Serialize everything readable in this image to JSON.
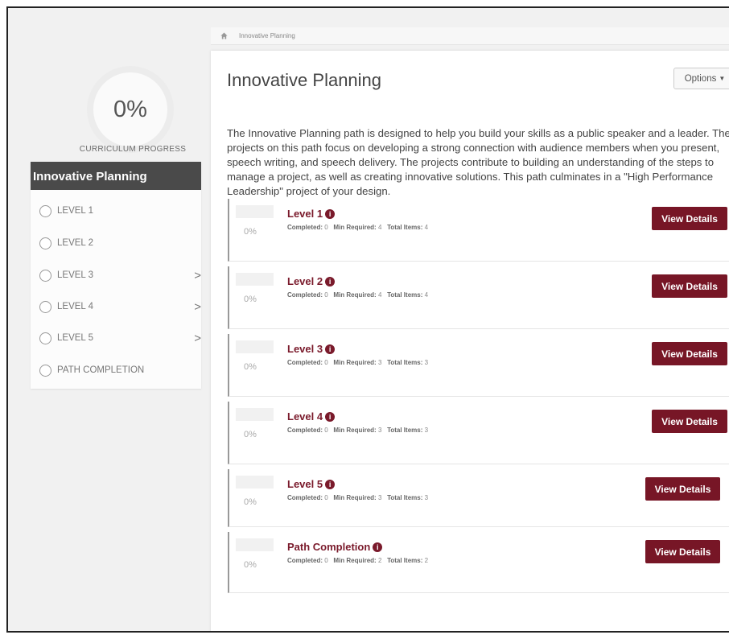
{
  "curriculum": {
    "percent": "0%",
    "label": "CURRICULUM PROGRESS"
  },
  "sidebar": {
    "title": "Innovative Planning",
    "items": [
      {
        "label": "LEVEL 1",
        "chevron": ""
      },
      {
        "label": "LEVEL 2",
        "chevron": ""
      },
      {
        "label": "LEVEL 3",
        "chevron": ">"
      },
      {
        "label": "LEVEL 4",
        "chevron": ">"
      },
      {
        "label": "LEVEL 5",
        "chevron": ">"
      },
      {
        "label": "PATH COMPLETION",
        "chevron": ""
      }
    ]
  },
  "breadcrumb": {
    "home_icon": "home-icon",
    "current": "Innovative Planning"
  },
  "main": {
    "title": "Innovative Planning",
    "options_label": "Options",
    "description": "The Innovative Planning path is designed to help you build your skills as a public speaker and a leader. The projects on this path focus on developing a strong connection with audience members when you present, speech writing, and speech delivery. The projects contribute to building an understanding of the steps to manage a project, as well as creating innovative solutions. This path culminates in a \"High Performance Leadership\" project of your design.",
    "levels": [
      {
        "title": "Level 1",
        "percent": "0%",
        "completed_label": "Completed:",
        "completed": "0",
        "min_label": "Min Required:",
        "min_required": "4",
        "total_label": "Total Items:",
        "total_items": "4",
        "button": "View Details"
      },
      {
        "title": "Level 2",
        "percent": "0%",
        "completed_label": "Completed:",
        "completed": "0",
        "min_label": "Min Required:",
        "min_required": "4",
        "total_label": "Total Items:",
        "total_items": "4",
        "button": "View Details"
      },
      {
        "title": "Level 3",
        "percent": "0%",
        "completed_label": "Completed:",
        "completed": "0",
        "min_label": "Min Required:",
        "min_required": "3",
        "total_label": "Total Items:",
        "total_items": "3",
        "button": "View Details"
      },
      {
        "title": "Level 4",
        "percent": "0%",
        "completed_label": "Completed:",
        "completed": "0",
        "min_label": "Min Required:",
        "min_required": "3",
        "total_label": "Total Items:",
        "total_items": "3",
        "button": "View Details"
      },
      {
        "title": "Level 5",
        "percent": "0%",
        "completed_label": "Completed:",
        "completed": "0",
        "min_label": "Min Required:",
        "min_required": "3",
        "total_label": "Total Items:",
        "total_items": "3",
        "button": "View Details"
      },
      {
        "title": "Path Completion",
        "percent": "0%",
        "completed_label": "Completed:",
        "completed": "0",
        "min_label": "Min Required:",
        "min_required": "2",
        "total_label": "Total Items:",
        "total_items": "2",
        "button": "View Details"
      }
    ]
  },
  "colors": {
    "accent": "#771626",
    "sidebar_header": "#4a4a4a"
  }
}
